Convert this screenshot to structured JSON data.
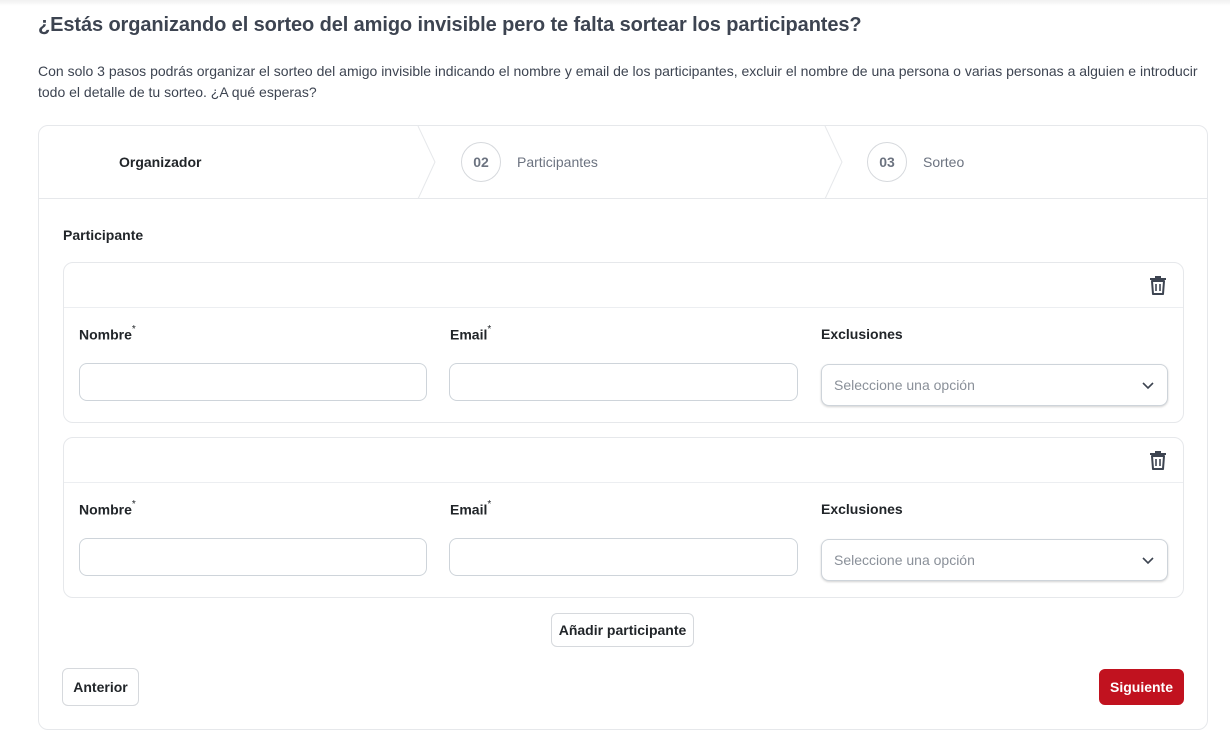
{
  "header": {
    "title": "¿Estás organizando el sorteo del amigo invisible pero te falta sortear los participantes?",
    "intro": "Con solo 3 pasos podrás organizar el sorteo del amigo invisible indicando el nombre y email de los participantes, excluir el nombre de una persona o varias personas a alguien e introducir todo el detalle de tu sorteo. ¿A qué esperas?"
  },
  "steps": [
    {
      "number": "",
      "label": "Organizador",
      "state": "completed"
    },
    {
      "number": "02",
      "label": "Participantes",
      "state": "current"
    },
    {
      "number": "03",
      "label": "Sorteo",
      "state": "upcoming"
    }
  ],
  "form": {
    "section_label": "Participante",
    "participants": [
      {
        "name_label": "Nombre",
        "name_value": "",
        "name_required": "*",
        "email_label": "Email",
        "email_value": "",
        "email_required": "*",
        "exclusions_label": "Exclusiones",
        "exclusions_placeholder": "Seleccione una opción",
        "delete_icon": "trash-icon"
      },
      {
        "name_label": "Nombre",
        "name_value": "",
        "name_required": "*",
        "email_label": "Email",
        "email_value": "",
        "email_required": "*",
        "exclusions_label": "Exclusiones",
        "exclusions_placeholder": "Seleccione una opción",
        "delete_icon": "trash-icon"
      }
    ],
    "add_participant_label": "Añadir participante"
  },
  "nav": {
    "prev_label": "Anterior",
    "next_label": "Siguiente"
  },
  "colors": {
    "primary": "#c1121f",
    "border": "#e6e8eb",
    "title": "#3d4451",
    "muted": "#6c7380"
  }
}
